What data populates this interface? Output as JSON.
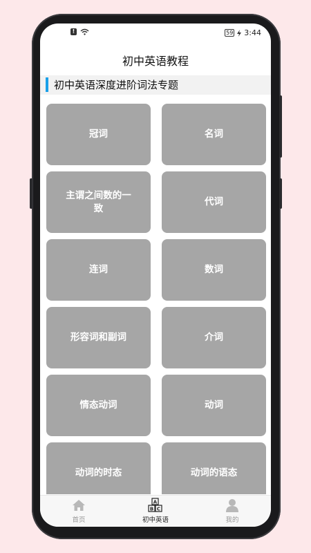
{
  "status_bar": {
    "time": "3:44",
    "battery": "59"
  },
  "header": {
    "title": "初中英语教程"
  },
  "section": {
    "title": "初中英语深度进阶词法专题"
  },
  "topics": [
    "冠词",
    "名词",
    "主谓之间数的一致",
    "代词",
    "连词",
    "数词",
    "形容词和副词",
    "介词",
    "情态动词",
    "动词",
    "动词的时态",
    "动词的语态"
  ],
  "tabs": [
    {
      "label": "首页",
      "icon": "home-icon",
      "active": false
    },
    {
      "label": "初中英语",
      "icon": "abc-blocks-icon",
      "active": true
    },
    {
      "label": "我的",
      "icon": "user-icon",
      "active": false
    }
  ],
  "colors": {
    "accent": "#1aa0e8",
    "card": "#a6a6a6",
    "background": "#fde8ea"
  }
}
